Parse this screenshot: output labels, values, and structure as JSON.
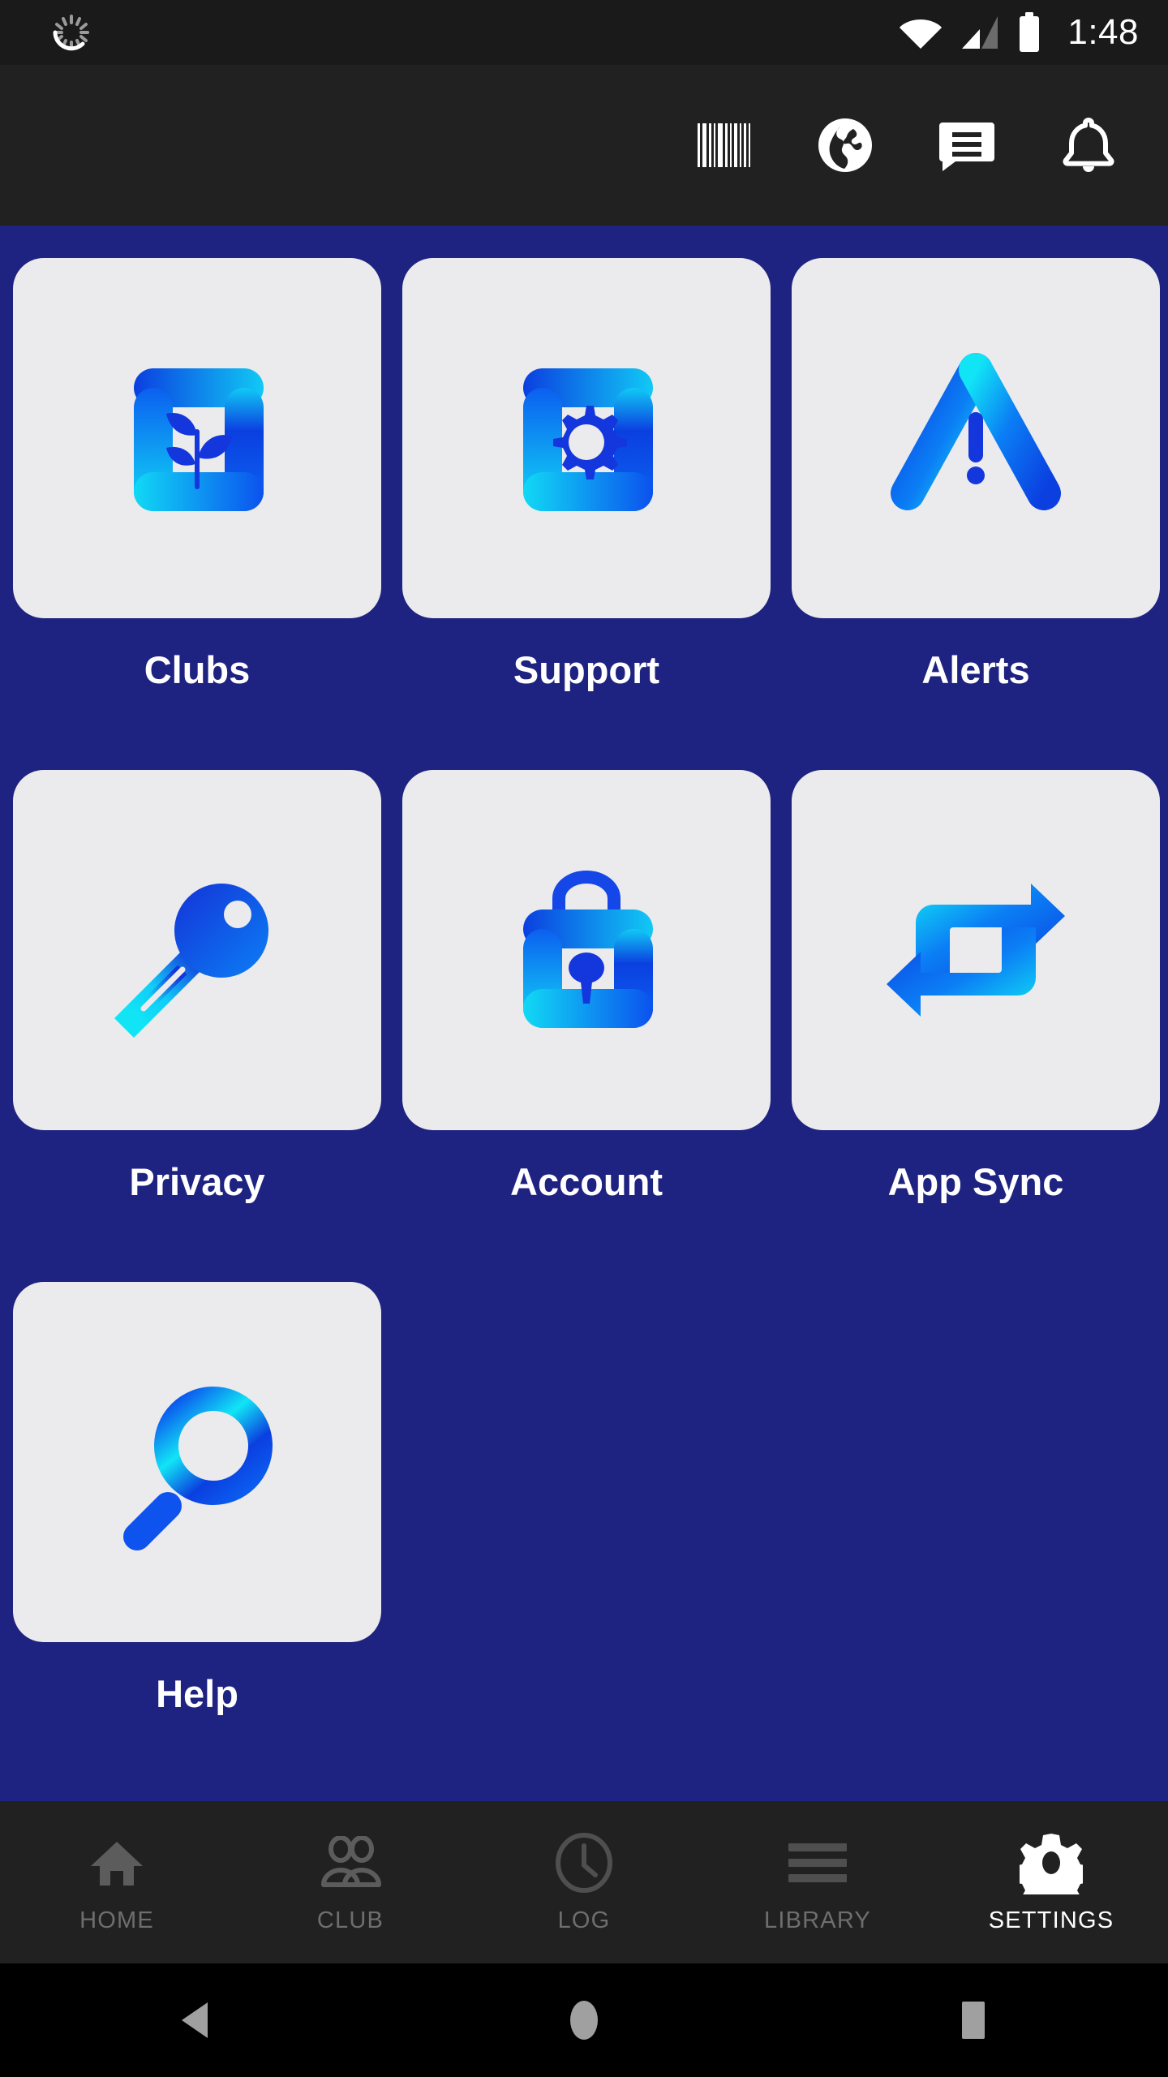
{
  "status_bar": {
    "time": "1:48",
    "icons": [
      "spinner-icon",
      "wifi-icon",
      "cellular-signal-icon",
      "battery-icon"
    ]
  },
  "toolbar": {
    "actions": [
      {
        "name": "barcode-scan-button",
        "icon": "barcode-icon"
      },
      {
        "name": "globe-button",
        "icon": "globe-icon"
      },
      {
        "name": "messages-button",
        "icon": "chat-bubble-icon"
      },
      {
        "name": "notifications-button",
        "icon": "bell-icon"
      }
    ]
  },
  "grid": {
    "tiles": [
      {
        "label": "Clubs",
        "icon": "bracket-frame-plant-icon"
      },
      {
        "label": "Support",
        "icon": "bracket-frame-gear-icon"
      },
      {
        "label": "Alerts",
        "icon": "warning-triangle-icon"
      },
      {
        "label": "Privacy",
        "icon": "key-icon"
      },
      {
        "label": "Account",
        "icon": "padlock-icon"
      },
      {
        "label": "App Sync",
        "icon": "sync-arrows-icon"
      },
      {
        "label": "Help",
        "icon": "magnifier-icon"
      }
    ]
  },
  "bottom_nav": {
    "items": [
      {
        "label": "HOME",
        "icon": "house-icon",
        "active": false
      },
      {
        "label": "CLUB",
        "icon": "people-icon",
        "active": false
      },
      {
        "label": "LOG",
        "icon": "clock-icon",
        "active": false
      },
      {
        "label": "LIBRARY",
        "icon": "hamburger-icon",
        "active": false
      },
      {
        "label": "SETTINGS",
        "icon": "gear-icon",
        "active": true
      }
    ]
  },
  "system_nav": {
    "buttons": [
      {
        "name": "back-button",
        "icon": "triangle-back-icon"
      },
      {
        "name": "home-button",
        "icon": "circle-home-icon"
      },
      {
        "name": "recents-button",
        "icon": "square-recents-icon"
      }
    ]
  },
  "colors": {
    "background": "#1e2280",
    "tile": "#ebebed",
    "toolbar": "#212121",
    "status_bar": "#1a1a1a",
    "system_nav": "#000000",
    "accent_blue": "#0b3fe0",
    "accent_cyan": "#11e5f5",
    "label_text": "#ffffff",
    "nav_inactive": "#6e6e6e"
  }
}
